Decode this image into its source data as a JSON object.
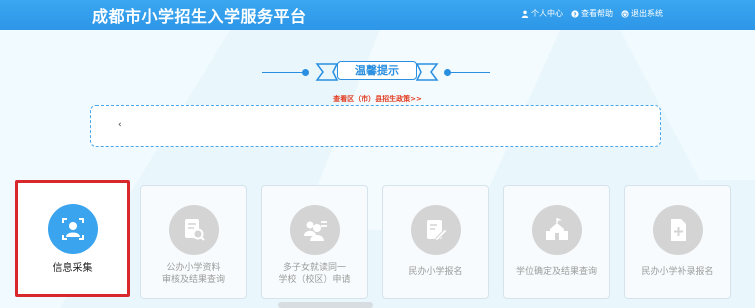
{
  "header": {
    "title": "成都市小学招生入学服务平台",
    "menu": [
      {
        "icon": "person-icon",
        "label": "个人中心"
      },
      {
        "icon": "help-icon",
        "label": "查看帮助"
      },
      {
        "icon": "power-icon",
        "label": "退出系统"
      }
    ]
  },
  "tip": {
    "title": "温馨提示",
    "policy_link": "查看区（市）县招生政策>>",
    "notice_marker": "‹"
  },
  "cards": [
    {
      "label_lines": [
        "信息采集"
      ],
      "icon": "user-scan-icon",
      "active": true
    },
    {
      "label_lines": [
        "公办小学资料",
        "审核及结果查询"
      ],
      "icon": "document-search-icon",
      "active": false
    },
    {
      "label_lines": [
        "多子女就读同一",
        "学校（校区）申请"
      ],
      "icon": "multi-children-icon",
      "active": false
    },
    {
      "label_lines": [
        "民办小学报名"
      ],
      "icon": "edit-form-icon",
      "active": false
    },
    {
      "label_lines": [
        "学位确定及结果查询"
      ],
      "icon": "school-building-icon",
      "active": false
    },
    {
      "label_lines": [
        "民办小学补录报名"
      ],
      "icon": "add-document-icon",
      "active": false
    }
  ],
  "colors": {
    "header": "#2d96e8",
    "accent": "#2a8fe0",
    "active_border": "#d8282b",
    "link": "#e23a1e"
  }
}
